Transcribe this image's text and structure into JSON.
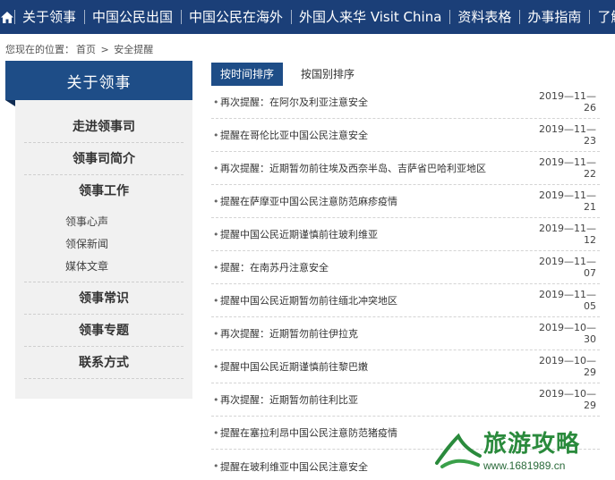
{
  "topnav": {
    "items": [
      "关于领事",
      "中国公民出国",
      "中国公民在海外",
      "外国人来华 Visit China",
      "资料表格",
      "办事指南",
      "了解目"
    ]
  },
  "breadcrumb": {
    "prefix": "您现在的位置：",
    "home": "首页",
    "sep": ">",
    "current": "安全提醒"
  },
  "sidebar": {
    "heading": "关于领事",
    "items": [
      {
        "label": "走进领事司"
      },
      {
        "label": "领事司简介"
      },
      {
        "label": "领事工作"
      }
    ],
    "subitems": [
      "领事心声",
      "领保新闻",
      "媒体文章"
    ],
    "items2": [
      {
        "label": "领事常识"
      },
      {
        "label": "领事专题"
      },
      {
        "label": "联系方式"
      }
    ]
  },
  "tabs": {
    "by_time": "按时间排序",
    "by_country": "按国别排序"
  },
  "list": [
    {
      "title": "再次提醒：在阿尔及利亚注意安全",
      "date": "2019—11—26"
    },
    {
      "title": "提醒在哥伦比亚中国公民注意安全",
      "date": "2019—11—23"
    },
    {
      "title": "再次提醒：近期暂勿前往埃及西奈半岛、吉萨省巴哈利亚地区",
      "date": "2019—11—22"
    },
    {
      "title": "提醒在萨摩亚中国公民注意防范麻疹疫情",
      "date": "2019—11—21"
    },
    {
      "title": "提醒中国公民近期谨慎前往玻利维亚",
      "date": "2019—11—12"
    },
    {
      "title": "提醒：在南苏丹注意安全",
      "date": "2019—11—07"
    },
    {
      "title": "提醒中国公民近期暂勿前往缅北冲突地区",
      "date": "2019—11—05"
    },
    {
      "title": "再次提醒：近期暂勿前往伊拉克",
      "date": "2019—10—30"
    },
    {
      "title": "提醒中国公民近期谨慎前往黎巴嫩",
      "date": "2019—10—29"
    },
    {
      "title": "再次提醒：近期暂勿前往利比亚",
      "date": "2019—10—29"
    },
    {
      "title": "提醒在塞拉利昂中国公民注意防范猪疫情",
      "date": ""
    },
    {
      "title": "提醒在玻利维亚中国公民注意安全",
      "date": ""
    }
  ],
  "watermark": {
    "title": "旅游攻略",
    "url": "www.1681989.cn"
  },
  "colors": {
    "nav_bg": "#1b3f78",
    "accent": "#1e4d87",
    "watermark": "#2a8a3c"
  }
}
